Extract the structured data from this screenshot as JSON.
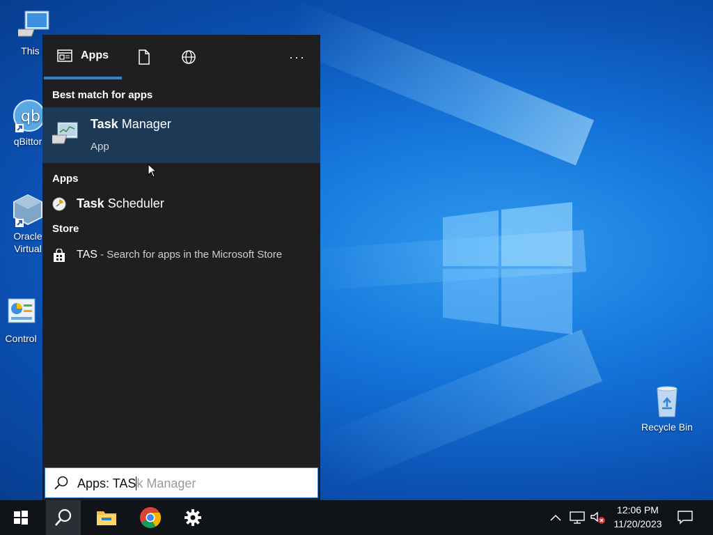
{
  "desktop": {
    "icons": [
      {
        "label": "This P",
        "icon": "computer-icon"
      },
      {
        "label": "qBittor",
        "icon": "qbittorrent-icon"
      },
      {
        "label": "Oracle\nVirtual",
        "icon": "virtualbox-icon"
      },
      {
        "label": "Control",
        "icon": "control-panel-icon"
      },
      {
        "label": "Recycle Bin",
        "icon": "recycle-bin-icon"
      }
    ],
    "oracle_line1": "Oracle",
    "oracle_line2": "Virtual"
  },
  "search_panel": {
    "tabs": {
      "apps": "Apps",
      "documents_icon": "document-icon",
      "web_icon": "globe-icon",
      "more": "···"
    },
    "best_match_header": "Best match for apps",
    "best_match": {
      "bold": "Task",
      "rest": " Manager",
      "subtitle": "App",
      "icon": "task-manager-icon"
    },
    "apps_header": "Apps",
    "apps": [
      {
        "bold": "Task",
        "rest": " Scheduler",
        "icon": "task-scheduler-icon"
      }
    ],
    "store_header": "Store",
    "store": {
      "query": "TAS",
      "suffix": " - Search for apps in the Microsoft Store",
      "icon": "store-icon"
    }
  },
  "searchbox": {
    "typed": "Apps: TAS",
    "completion": "k Manager"
  },
  "taskbar": {
    "items": [
      "start-icon",
      "search-icon",
      "file-explorer-icon",
      "chrome-icon",
      "settings-icon"
    ],
    "clock_time": "12:06 PM",
    "clock_date": "11/20/2023"
  },
  "colors": {
    "accent": "#2f83d3",
    "panel": "#1f1f1f",
    "selected": "#1c3a55",
    "taskbar": "#101418"
  }
}
